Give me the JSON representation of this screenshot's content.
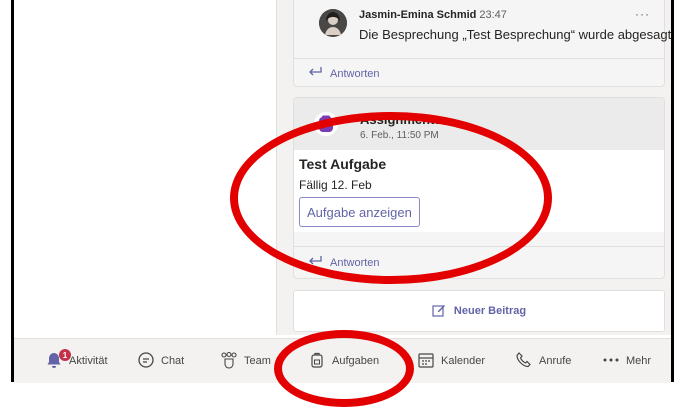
{
  "post1": {
    "author": "Jasmin-Emina Schmid",
    "time": "23:47",
    "message": "Die Besprechung „Test Besprechung“ wurde abgesagt",
    "reply_label": "Antworten",
    "more": "···"
  },
  "post2": {
    "app_name": "Assignments",
    "date": "6. Feb., 11:50 PM",
    "task_title": "Test Aufgabe",
    "due": "Fällig 12. Feb",
    "button_label": "Aufgabe anzeigen",
    "reply_label": "Antworten"
  },
  "new_post": {
    "label": "Neuer Beitrag"
  },
  "bottom_nav": {
    "items": [
      {
        "label": "Aktivität",
        "icon": "bell-icon",
        "badge": "1"
      },
      {
        "label": "Chat",
        "icon": "chat-icon"
      },
      {
        "label": "Team",
        "icon": "teams-icon"
      },
      {
        "label": "Aufgaben",
        "icon": "assignments-icon"
      },
      {
        "label": "Kalender",
        "icon": "calendar-icon"
      },
      {
        "label": "Anrufe",
        "icon": "phone-icon"
      },
      {
        "label": "Mehr",
        "icon": "more-icon"
      }
    ]
  },
  "colors": {
    "accent": "#6264a7",
    "annotation": "#e30000",
    "badge": "#c4314b",
    "app_icon": "#7a3bb3"
  }
}
